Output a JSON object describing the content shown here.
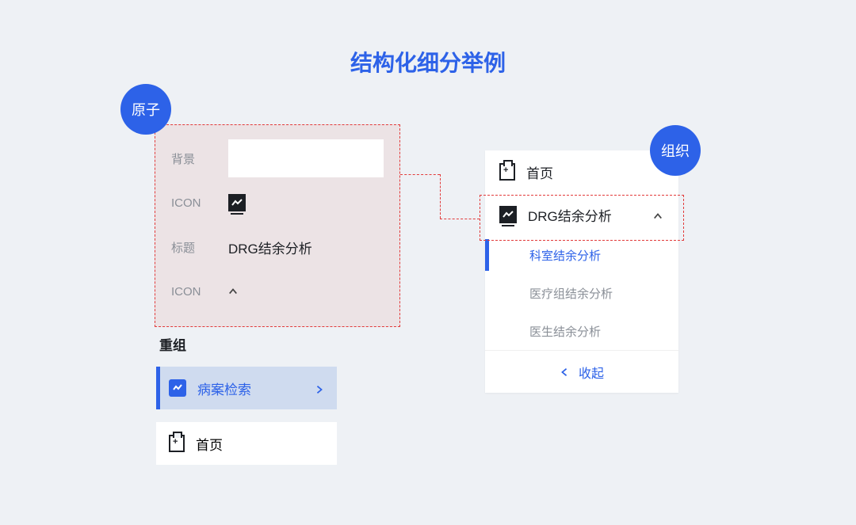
{
  "title": "结构化细分举例",
  "badges": {
    "atom": "原子",
    "org": "组织"
  },
  "atom": {
    "labels": {
      "background": "背景",
      "icon1": "ICON",
      "title": "标题",
      "icon2": "ICON"
    },
    "title_value": "DRG结余分析"
  },
  "recompose": {
    "heading": "重组",
    "items": [
      {
        "label": "病案检索",
        "active": true,
        "icon": "chart-search"
      },
      {
        "label": "首页",
        "active": false,
        "icon": "clipboard"
      }
    ]
  },
  "org": {
    "items": [
      {
        "label": "首页",
        "icon": "clipboard",
        "expandable": false
      },
      {
        "label": "DRG结余分析",
        "icon": "chart-monitor",
        "expandable": true,
        "expanded": true,
        "highlighted": true
      }
    ],
    "sub_items": [
      {
        "label": "科室结余分析",
        "active": true
      },
      {
        "label": "医疗组结余分析",
        "active": false
      },
      {
        "label": "医生结余分析",
        "active": false
      }
    ],
    "collapse_label": "收起"
  }
}
